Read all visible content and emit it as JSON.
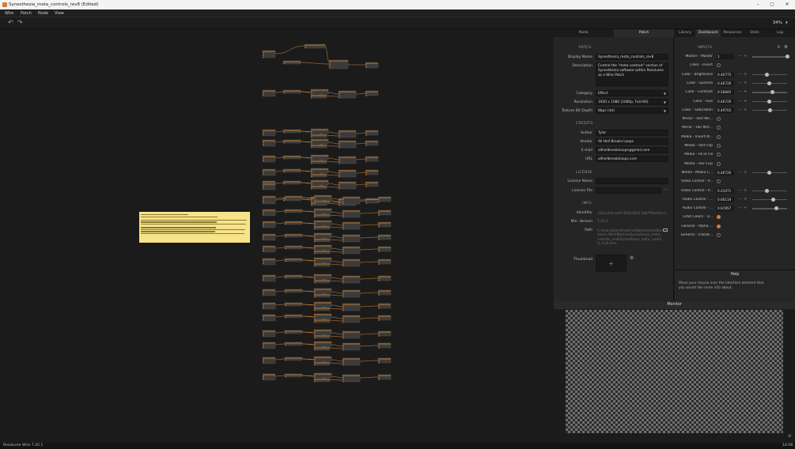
{
  "window": {
    "title": "Synesthesia_meta_controls_rev8 (Edited)",
    "controls": [
      "–",
      "▢",
      "✕"
    ]
  },
  "menu": [
    "Wire",
    "Patch",
    "Node",
    "View"
  ],
  "toolbar": {
    "zoom": "34%"
  },
  "note_lines": 9,
  "left_panel": {
    "tabs": [
      {
        "label": "Node",
        "active": false
      },
      {
        "label": "Patch",
        "active": true
      }
    ],
    "patch_header": "PATCH",
    "display_name_label": "Display Name",
    "display_name": "Synesthesia_meta_controls_rev8",
    "description_label": "Description",
    "description": "Control the \"meta controls\" section of Synesthesia software within Resolume as a Wire Patch",
    "category_label": "Category",
    "category": "Effect",
    "resolution_label": "Resolution",
    "resolution": "1920 x 1080 (1080p, Full HD)",
    "bitdepth_label": "Texture Bit Depth",
    "bitdepth": "8bpc (int)",
    "credits_header": "CREDITS",
    "author_label": "Author",
    "author": "Tyler",
    "vendor_label": "Vendor",
    "vendor": "All Hell Breaks Loops",
    "email_label": "E-mail",
    "email": "allhellbreaksloops@gmail.com",
    "url_label": "URL",
    "url": "allhellbreaksloops.com",
    "license_header": "LICENSE",
    "license_name_label": "License Name",
    "license_file_label": "License File",
    "license_file_more": "···",
    "info_header": "INFO",
    "identifier_label": "Identifier",
    "identifier": "{0a2a3c6-ae10-4010-b952-3b879f4eb4cc}",
    "minversion_label": "Min. Version",
    "minversion": "7.20.1",
    "path_label": "Path",
    "path": "C:\\Users\\tyler\\OneDrive\\Documents\\Resolume Wire\\Patches\\Synesthesia_meta_controls_rev8\\Synesthesia_meta_controls_rev8.wire",
    "thumbnail_label": "Thumbnail",
    "thumbnail_plus": "+"
  },
  "right_panel": {
    "tabs": [
      {
        "label": "Library",
        "active": false
      },
      {
        "label": "Dashboard",
        "active": true
      },
      {
        "label": "Resources",
        "active": false
      },
      {
        "label": "Stats",
        "active": false
      },
      {
        "label": "Log",
        "active": false
      }
    ],
    "inputs_header": "INPUTS",
    "inputs_r": "R",
    "params": [
      {
        "label": "Master - Master",
        "type": "slider",
        "value": "1",
        "level": 1.0
      },
      {
        "label": "Color - Invert",
        "type": "check",
        "on": false
      },
      {
        "label": "Color - Brightness",
        "type": "slider",
        "value": "0.40775",
        "level": 0.41
      },
      {
        "label": "Color - Gamma",
        "type": "slider",
        "value": "0.46726",
        "level": 0.47
      },
      {
        "label": "Color - Contrast",
        "type": "slider",
        "value": "0.56845",
        "level": 0.57
      },
      {
        "label": "Color - Hue",
        "type": "slider",
        "value": "0.46726",
        "level": 0.47
      },
      {
        "label": "Color - Saturation",
        "type": "slider",
        "value": "0.49702",
        "level": 0.5
      },
      {
        "label": "Mirror - Vert Mir...",
        "type": "check",
        "on": false
      },
      {
        "label": "Mirror - Hor Mirr...",
        "type": "check",
        "on": false
      },
      {
        "label": "Media - Invert M...",
        "type": "check",
        "on": false
      },
      {
        "label": "Media - Vert Flip",
        "type": "check",
        "on": false
      },
      {
        "label": "Media - Fit or Fill",
        "type": "check",
        "on": false
      },
      {
        "label": "Media - Hor FLip",
        "type": "check",
        "on": false
      },
      {
        "label": "Media - Media C...",
        "type": "slider",
        "value": "0.46726",
        "level": 0.47
      },
      {
        "label": "Video Control - P...",
        "type": "check",
        "on": false
      },
      {
        "label": "Video Control - P...",
        "type": "slider",
        "value": "0.41071",
        "level": 0.41
      },
      {
        "label": "Audio Control - ...",
        "type": "slider",
        "value": "0.60119",
        "level": 0.6
      },
      {
        "label": "Audio Control - ...",
        "type": "slider",
        "value": "0.67857",
        "level": 0.68
      },
      {
        "label": "Limit Colors - U...",
        "type": "check",
        "on": true
      },
      {
        "label": "General - Alpha ...",
        "type": "check",
        "on": true
      },
      {
        "label": "General - Transit...",
        "type": "check",
        "on": false
      }
    ],
    "help_title": "Help",
    "help_text": "Move your mouse over the Interface element that you would like more info about."
  },
  "monitor": {
    "title": "Monitor"
  },
  "status": {
    "version": "Resolume Wire 7.20.1",
    "time": "14:08"
  }
}
